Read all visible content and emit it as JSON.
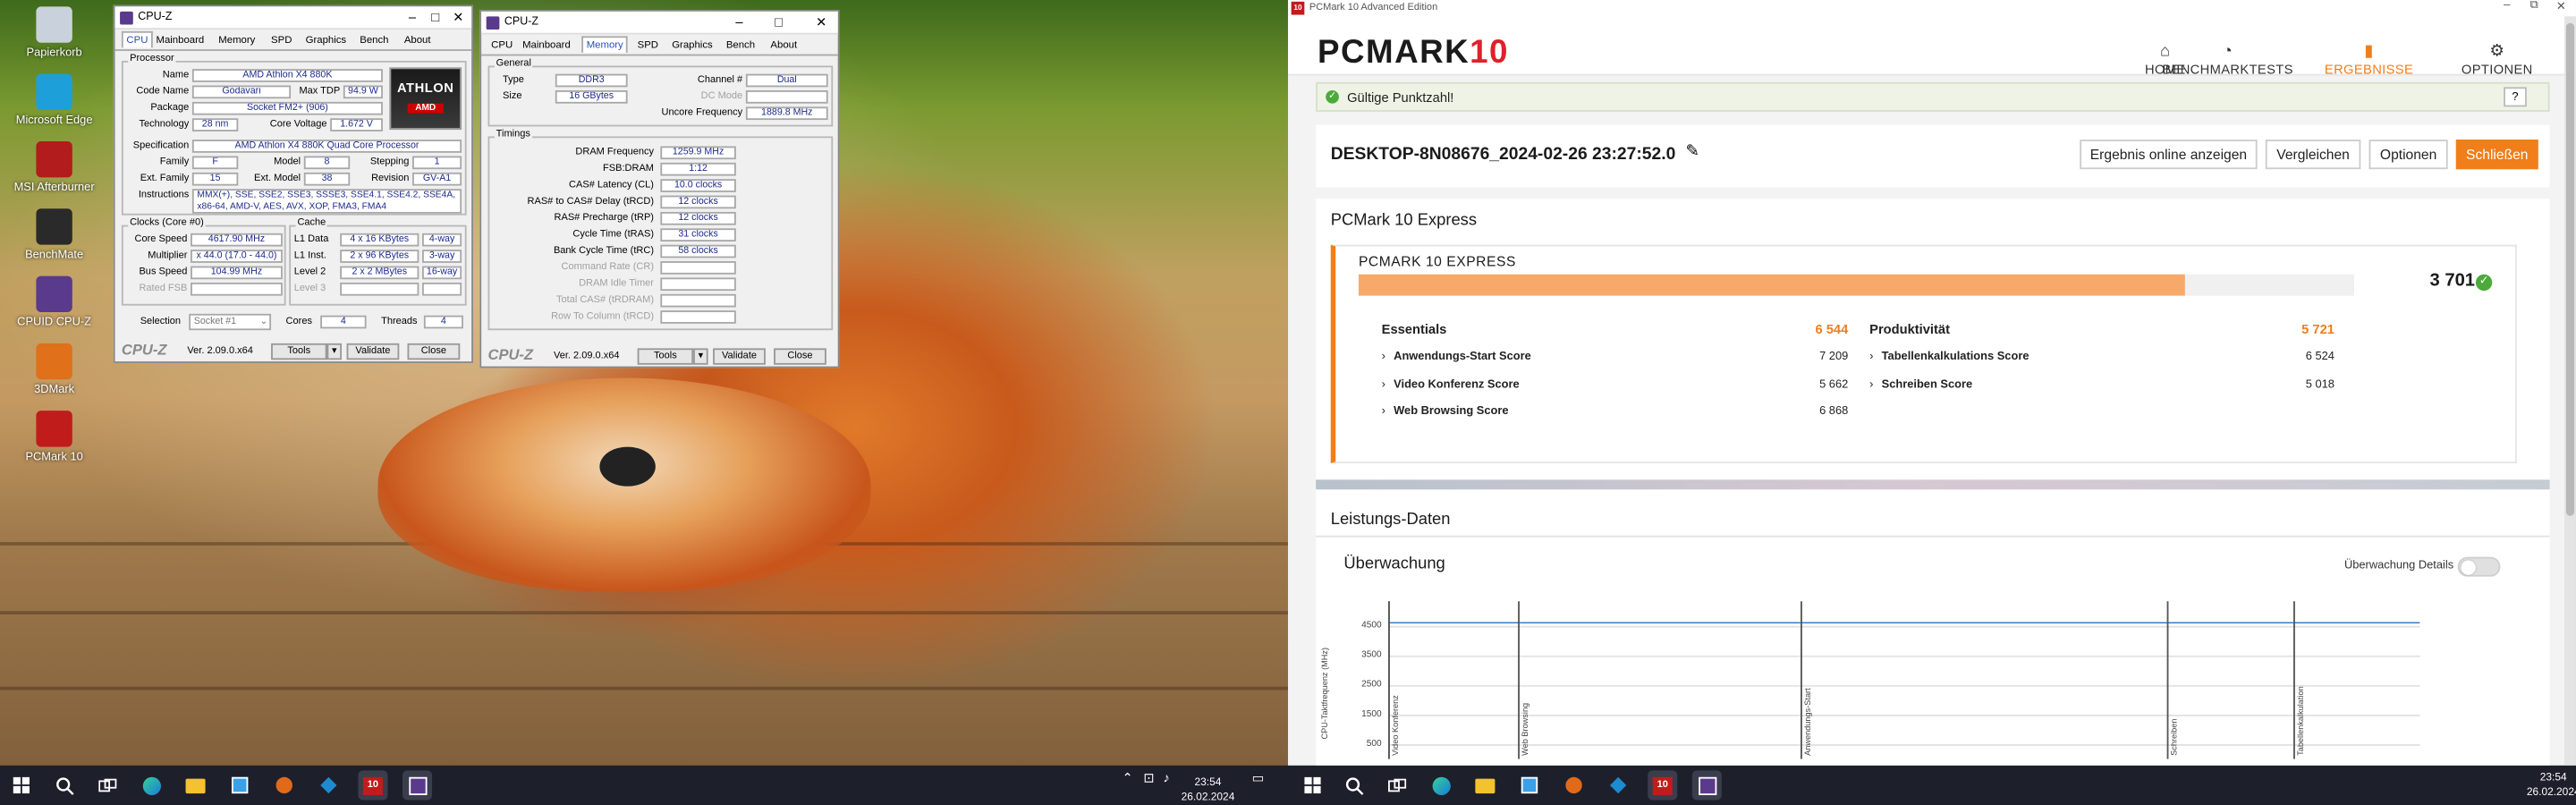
{
  "desktop": {
    "icons": [
      {
        "label": "Papierkorb",
        "icon": "recycle-bin-icon",
        "color": "#c9d2dc"
      },
      {
        "label": "Microsoft Edge",
        "icon": "edge-icon",
        "color": "#1d9fd9"
      },
      {
        "label": "MSI Afterburner",
        "icon": "afterburner-icon",
        "color": "#b21c1c"
      },
      {
        "label": "BenchMate",
        "icon": "benchmate-icon",
        "color": "#2a2a2a"
      },
      {
        "label": "CPUID CPU-Z",
        "icon": "cpuz-icon",
        "color": "#5a3a8c"
      },
      {
        "label": "3DMark",
        "icon": "3dmark-icon",
        "color": "#e0701a"
      },
      {
        "label": "PCMark 10",
        "icon": "pcmark-icon",
        "color": "#c01c1c"
      }
    ]
  },
  "cpuz1": {
    "title": "CPU-Z",
    "tabs": [
      "CPU",
      "Mainboard",
      "Memory",
      "SPD",
      "Graphics",
      "Bench",
      "About"
    ],
    "active_tab": "CPU",
    "processor": {
      "group": "Processor",
      "name_label": "Name",
      "name": "AMD Athlon X4 880K",
      "codename_label": "Code Name",
      "codename": "Godavari",
      "maxtdp_label": "Max TDP",
      "maxtdp": "94.9 W",
      "package_label": "Package",
      "package": "Socket FM2+ (906)",
      "technology_label": "Technology",
      "technology": "28 nm",
      "corevoltage_label": "Core Voltage",
      "corevoltage": "1.672 V",
      "spec_label": "Specification",
      "spec": "AMD Athlon X4 880K Quad Core Processor",
      "family_label": "Family",
      "family": "F",
      "model_label": "Model",
      "model": "8",
      "stepping_label": "Stepping",
      "stepping": "1",
      "extfamily_label": "Ext. Family",
      "extfamily": "15",
      "extmodel_label": "Ext. Model",
      "extmodel": "38",
      "revision_label": "Revision",
      "revision": "GV-A1",
      "instructions_label": "Instructions",
      "instructions1": "MMX(+), SSE, SSE2, SSE3, SSSE3, SSE4.1, SSE4.2, SSE4A,",
      "instructions2": "x86-64, AMD-V, AES, AVX, XOP, FMA3, FMA4",
      "logo_text": "ATHLON",
      "logo_brand": "AMD"
    },
    "clocks": {
      "group": "Clocks (Core #0)",
      "corespeed_label": "Core Speed",
      "corespeed": "4617.90 MHz",
      "multiplier_label": "Multiplier",
      "multiplier": "x 44.0 (17.0 - 44.0)",
      "busspeed_label": "Bus Speed",
      "busspeed": "104.99 MHz",
      "ratedfsb_label": "Rated FSB"
    },
    "cache": {
      "group": "Cache",
      "l1d_label": "L1 Data",
      "l1d": "4 x 16 KBytes",
      "l1d_way": "4-way",
      "l1i_label": "L1 Inst.",
      "l1i": "2 x 96 KBytes",
      "l1i_way": "3-way",
      "l2_label": "Level 2",
      "l2": "2 x 2 MBytes",
      "l2_way": "16-way",
      "l3_label": "Level 3"
    },
    "selection_label": "Selection",
    "selection": "Socket #1",
    "cores_label": "Cores",
    "cores": "4",
    "threads_label": "Threads",
    "threads": "4",
    "brand": "CPU-Z",
    "version": "Ver. 2.09.0.x64",
    "tools": "Tools",
    "validate": "Validate",
    "close": "Close"
  },
  "cpuz2": {
    "title": "CPU-Z",
    "tabs": [
      "CPU",
      "Mainboard",
      "Memory",
      "SPD",
      "Graphics",
      "Bench",
      "About"
    ],
    "active_tab": "Memory",
    "general": {
      "group": "General",
      "type_label": "Type",
      "type": "DDR3",
      "size_label": "Size",
      "size": "16 GBytes",
      "channel_label": "Channel #",
      "channel": "Dual",
      "dcmode_label": "DC Mode",
      "uncore_label": "Uncore Frequency",
      "uncore": "1889.8 MHz"
    },
    "timings": {
      "group": "Timings",
      "rows": [
        {
          "label": "DRAM Frequency",
          "value": "1259.9 MHz",
          "enabled": true
        },
        {
          "label": "FSB:DRAM",
          "value": "1:12",
          "enabled": true
        },
        {
          "label": "CAS# Latency (CL)",
          "value": "10.0 clocks",
          "enabled": true
        },
        {
          "label": "RAS# to CAS# Delay (tRCD)",
          "value": "12 clocks",
          "enabled": true
        },
        {
          "label": "RAS# Precharge (tRP)",
          "value": "12 clocks",
          "enabled": true
        },
        {
          "label": "Cycle Time (tRAS)",
          "value": "31 clocks",
          "enabled": true
        },
        {
          "label": "Bank Cycle Time (tRC)",
          "value": "58 clocks",
          "enabled": true
        },
        {
          "label": "Command Rate (CR)",
          "value": "",
          "enabled": false
        },
        {
          "label": "DRAM Idle Timer",
          "value": "",
          "enabled": false
        },
        {
          "label": "Total CAS# (tRDRAM)",
          "value": "",
          "enabled": false
        },
        {
          "label": "Row To Column (tRCD)",
          "value": "",
          "enabled": false
        }
      ]
    },
    "brand": "CPU-Z",
    "version": "Ver. 2.09.0.x64",
    "tools": "Tools",
    "validate": "Validate",
    "close": "Close"
  },
  "pcmark": {
    "window_title": "PCMark 10 Advanced Edition",
    "logo": "PCMARK",
    "logo_num": "10",
    "nav": [
      {
        "label": "HOME",
        "icon": "home-icon",
        "glyph": "⌂",
        "active": false
      },
      {
        "label": "BENCHMARKTESTS",
        "icon": "gauge-icon",
        "glyph": "◔",
        "active": false
      },
      {
        "label": "ERGEBNISSE",
        "icon": "bar-chart-icon",
        "glyph": "▮",
        "active": true
      },
      {
        "label": "OPTIONEN",
        "icon": "gear-icon",
        "glyph": "⚙",
        "active": false
      }
    ],
    "valid_msg": "Gültige Punktzahl!",
    "help": "?",
    "result_name": "DESKTOP-8N08676_2024-02-26 23:27:52.0",
    "buttons": {
      "online": "Ergebnis online anzeigen",
      "compare": "Vergleichen",
      "options": "Optionen",
      "close": "Schließen"
    },
    "section_title": "PCMark 10 Express",
    "test_name": "PCMARK 10 EXPRESS",
    "score": "3 701",
    "score_fraction": 0.83,
    "essentials": {
      "label": "Essentials",
      "score": "6 544",
      "items": [
        {
          "label": "Anwendungs-Start Score",
          "score": "7 209"
        },
        {
          "label": "Video Konferenz Score",
          "score": "5 662"
        },
        {
          "label": "Web Browsing Score",
          "score": "6 868"
        }
      ]
    },
    "productivity": {
      "label": "Produktivität",
      "score": "5 721",
      "items": [
        {
          "label": "Tabellenkalkulations Score",
          "score": "6 524"
        },
        {
          "label": "Schreiben Score",
          "score": "5 018"
        }
      ]
    },
    "perf_title": "Leistungs-Daten",
    "monitor_title": "Überwachung",
    "monitor_details": "Überwachung Details",
    "chart_data": {
      "type": "line",
      "ylabel": "CPU-Taktfrequenz (MHz)",
      "yticks": [
        "4500",
        "3500",
        "2500",
        "1500",
        "500"
      ],
      "ylim": [
        0,
        4900
      ],
      "series": [
        {
          "values": [
            4617,
            4617,
            4617,
            4617,
            4617,
            4617,
            4617,
            4617,
            4617,
            4617
          ]
        }
      ],
      "x_range": [
        0,
        1
      ],
      "phase_markers": [
        {
          "label": "Video Konferenz",
          "pos": 0.0
        },
        {
          "label": "Web Browsing",
          "pos": 0.125
        },
        {
          "label": "Anwendungs-Start",
          "pos": 0.4
        },
        {
          "label": "Schreiben",
          "pos": 0.755
        },
        {
          "label": "Tabellenkalkulation",
          "pos": 0.878
        }
      ]
    }
  },
  "taskbar_left": {
    "time": "23:54",
    "date": "26.02.2024"
  },
  "taskbar_right": {
    "time": "23:54",
    "date": "26.02.2024"
  }
}
